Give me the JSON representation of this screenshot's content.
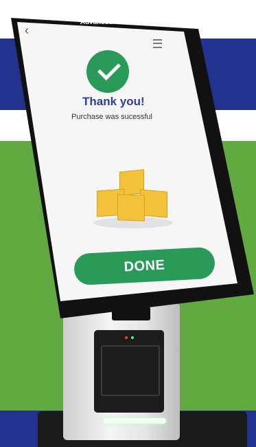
{
  "brand": "Advanced",
  "screen": {
    "title": "Thank you!",
    "message": "Purchase was sucessful",
    "done_label": "DONE"
  },
  "icons": {
    "back": "back-chevron-icon",
    "menu": "hamburger-menu-icon",
    "success": "check-circle-icon",
    "illustration": "boxes-illustration"
  },
  "colors": {
    "accent_green": "#2a9a59",
    "title_blue": "#2c3f9e",
    "background_blue": "#22338f",
    "background_green": "#62a942"
  }
}
